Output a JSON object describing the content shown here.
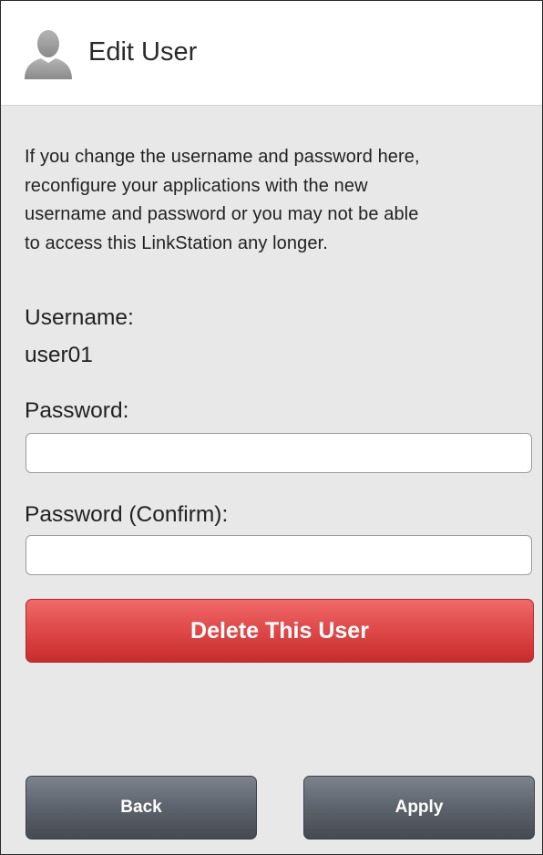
{
  "header": {
    "title": "Edit User",
    "icon": "user-silhouette-icon"
  },
  "warning": {
    "line1": "If you change the username and password here,",
    "line2": "reconfigure your applications with the new",
    "line3": "username and password or you may not be able",
    "line4": "to access this LinkStation any longer."
  },
  "form": {
    "username_label": "Username:",
    "username_value": "user01",
    "password_label": "Password:",
    "password_value": "",
    "password_confirm_label": "Password (Confirm):",
    "password_confirm_value": ""
  },
  "actions": {
    "delete_label": "Delete This User",
    "back_label": "Back",
    "apply_label": "Apply"
  },
  "colors": {
    "delete_accent": "#e04b4b",
    "nav_button": "#5d636c",
    "background": "#e8e8e8"
  }
}
